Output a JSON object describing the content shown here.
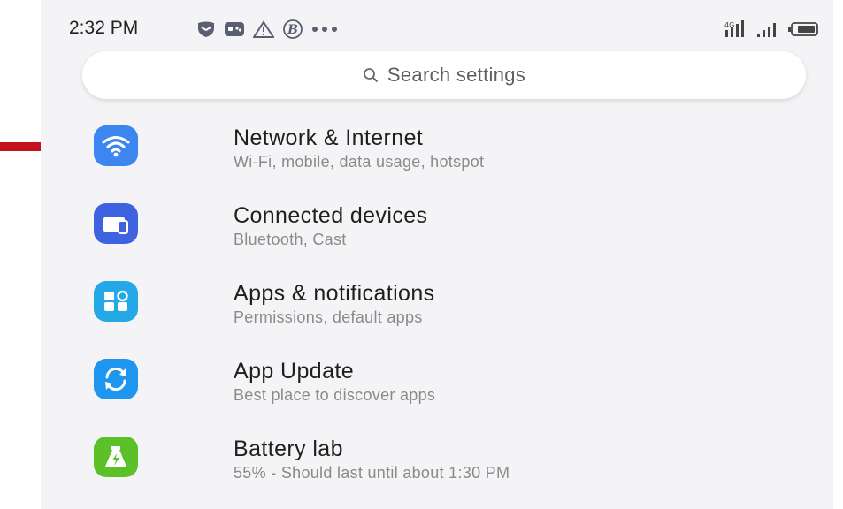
{
  "status_bar": {
    "time": "2:32 PM",
    "notification_icons": [
      "shield-icon",
      "game-controller-icon",
      "warning-icon",
      "b-circle-icon",
      "more-dots-icon"
    ],
    "system_icons": [
      "4g-signal-icon",
      "cellular-signal-icon",
      "battery-icon"
    ]
  },
  "search": {
    "placeholder": "Search settings"
  },
  "settings_items": [
    {
      "title": "Network & Internet",
      "subtitle": "Wi-Fi, mobile, data usage, hotspot",
      "icon": "wifi-icon",
      "color": "#3d86f0"
    },
    {
      "title": "Connected devices",
      "subtitle": "Bluetooth, Cast",
      "icon": "devices-icon",
      "color": "#3f63e0"
    },
    {
      "title": "Apps & notifications",
      "subtitle": "Permissions, default apps",
      "icon": "apps-grid-icon",
      "color": "#24a8e6"
    },
    {
      "title": "App Update",
      "subtitle": "Best place to discover apps",
      "icon": "sync-icon",
      "color": "#1e96f0"
    },
    {
      "title": "Battery lab",
      "subtitle": "55% - Should last until about 1:30 PM",
      "icon": "battery-flask-icon",
      "color": "#5cc128"
    }
  ],
  "annotation": {
    "arrow_color": "#c4121c"
  }
}
